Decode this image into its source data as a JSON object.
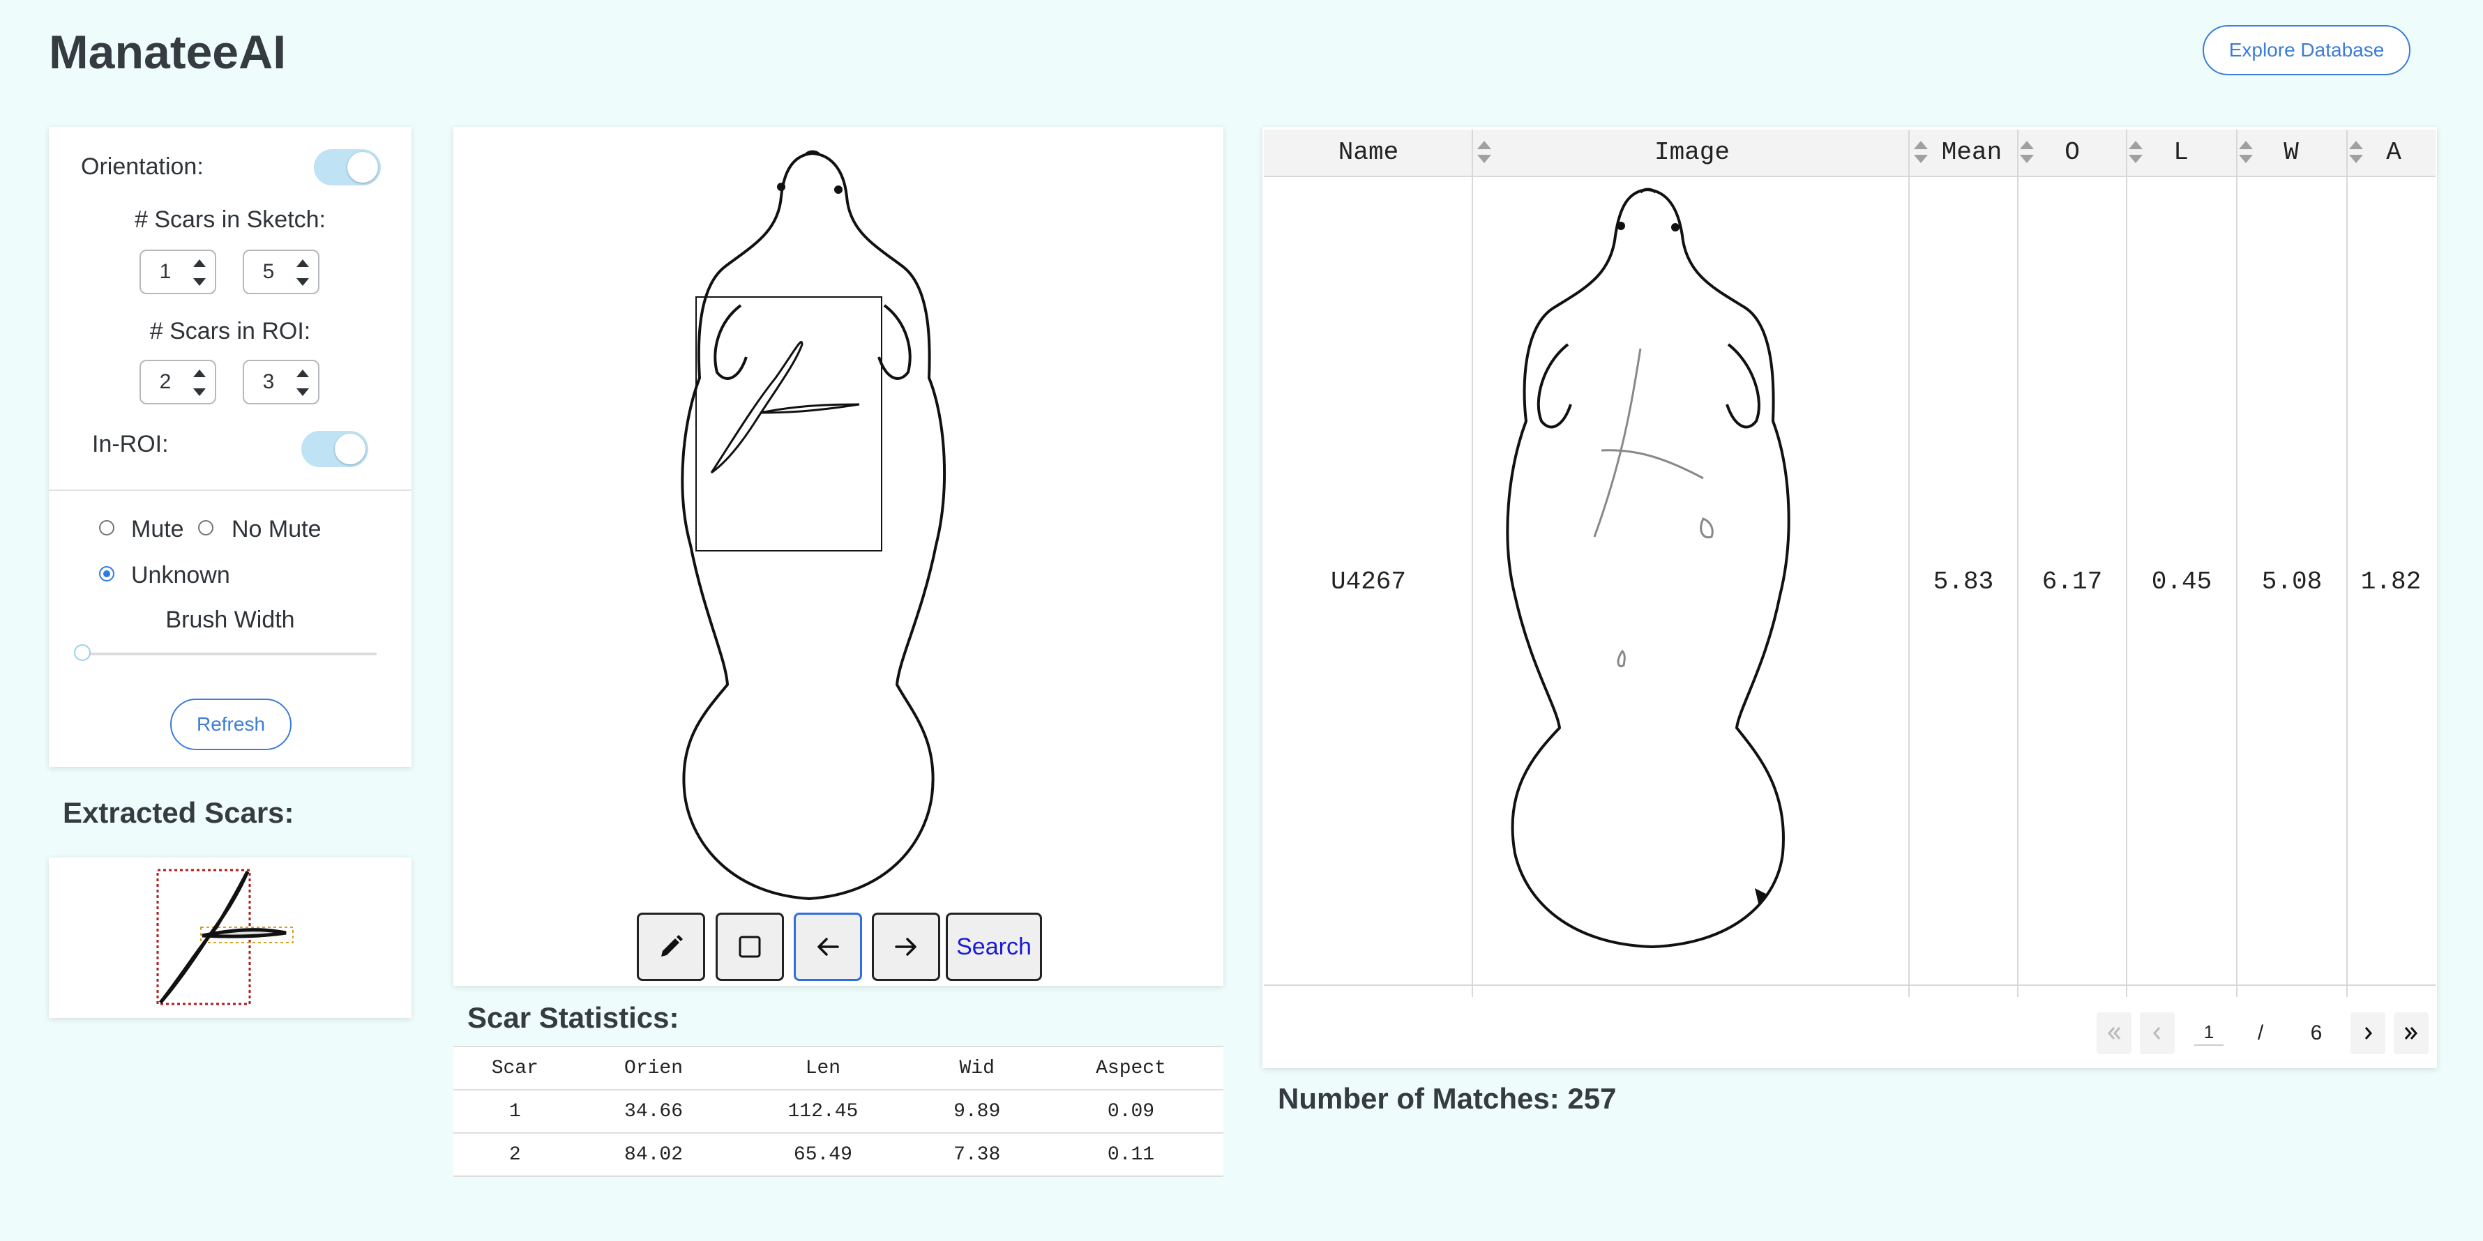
{
  "app": {
    "title": "ManateeAI",
    "explore_label": "Explore Database"
  },
  "controls": {
    "orientation_label": "Orientation:",
    "orientation_on": true,
    "scars_sketch_label": "# Scars in Sketch:",
    "scars_sketch_min": "1",
    "scars_sketch_max": "5",
    "scars_roi_label": "# Scars in ROI:",
    "scars_roi_min": "2",
    "scars_roi_max": "3",
    "in_roi_label": "In-ROI:",
    "in_roi_on": true,
    "mute_label": "Mute",
    "no_mute_label": "No Mute",
    "unknown_label": "Unknown",
    "selected_mute_option": "Unknown",
    "brush_label": "Brush Width",
    "brush_width_fraction": 0.0,
    "refresh_label": "Refresh"
  },
  "extracted": {
    "heading": "Extracted Scars:"
  },
  "toolbar": {
    "pencil_icon": "pencil-icon",
    "rect_icon": "square-icon",
    "undo_icon": "arrow-left-icon",
    "redo_icon": "arrow-right-icon",
    "search_label": "Search"
  },
  "stats": {
    "heading": "Scar Statistics:",
    "columns": [
      "Scar",
      "Orien",
      "Len",
      "Wid",
      "Aspect"
    ],
    "rows": [
      [
        "1",
        "34.66",
        "112.45",
        "9.89",
        "0.09"
      ],
      [
        "2",
        "84.02",
        "65.49",
        "7.38",
        "0.11"
      ]
    ]
  },
  "matches": {
    "columns": [
      "Name",
      "Image",
      "Mean",
      "O",
      "L",
      "W",
      "A"
    ],
    "row": {
      "name": "U4267",
      "mean": "5.83",
      "o": "6.17",
      "l": "0.45",
      "w": "5.08",
      "a": "1.82"
    },
    "pagination": {
      "current": "1",
      "separator": "/",
      "total": "6"
    },
    "count_text": "Number of Matches: 257"
  },
  "colors": {
    "background": "#effcfc",
    "accent": "#3b7dd8",
    "toggle": "#bfe2f5"
  }
}
